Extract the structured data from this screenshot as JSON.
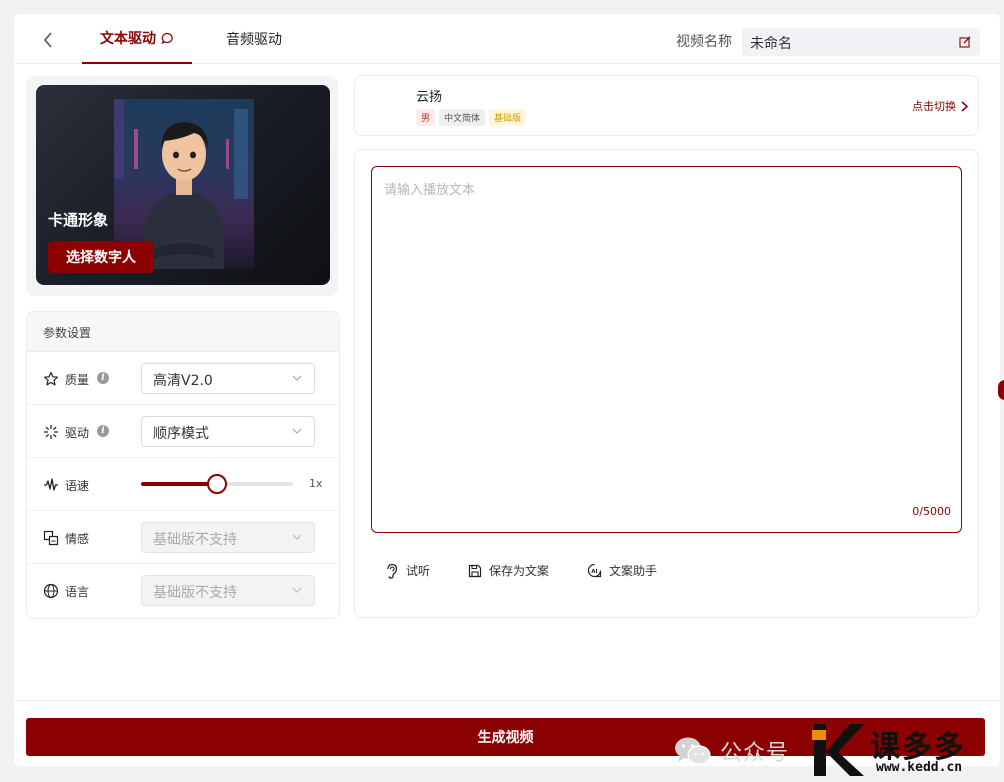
{
  "header": {
    "tabs": [
      {
        "label": "文本驱动",
        "active": true
      },
      {
        "label": "音频驱动",
        "active": false
      }
    ],
    "video_name_label": "视频名称",
    "video_name_value": "未命名"
  },
  "avatar": {
    "title": "卡通形象",
    "select_button": "选择数字人"
  },
  "params": {
    "title": "参数设置",
    "quality": {
      "label": "质量",
      "value": "高清V2.0"
    },
    "drive": {
      "label": "驱动",
      "value": "顺序模式"
    },
    "speed": {
      "label": "语速",
      "value_text": "1x",
      "level": 0.5
    },
    "emotion": {
      "label": "情感",
      "value": "基础版不支持"
    },
    "language": {
      "label": "语言",
      "value": "基础版不支持"
    }
  },
  "voice": {
    "name": "云扬",
    "tags": [
      "男",
      "中文简体",
      "基础版"
    ],
    "switch_label": "点击切换"
  },
  "editor": {
    "placeholder": "请输入播放文本",
    "counter": "0/5000"
  },
  "actions": {
    "listen": "试听",
    "save": "保存为文案",
    "assistant": "文案助手"
  },
  "footer": {
    "generate_button": "生成视频"
  },
  "watermark": {
    "gzh_text": "公众号",
    "brand": "课多多",
    "url": "www.kedd.cn"
  },
  "colors": {
    "accent": "#8b0000",
    "tag_male_bg": "#fdeaea",
    "tag_basic_bg": "#fff6dd"
  }
}
